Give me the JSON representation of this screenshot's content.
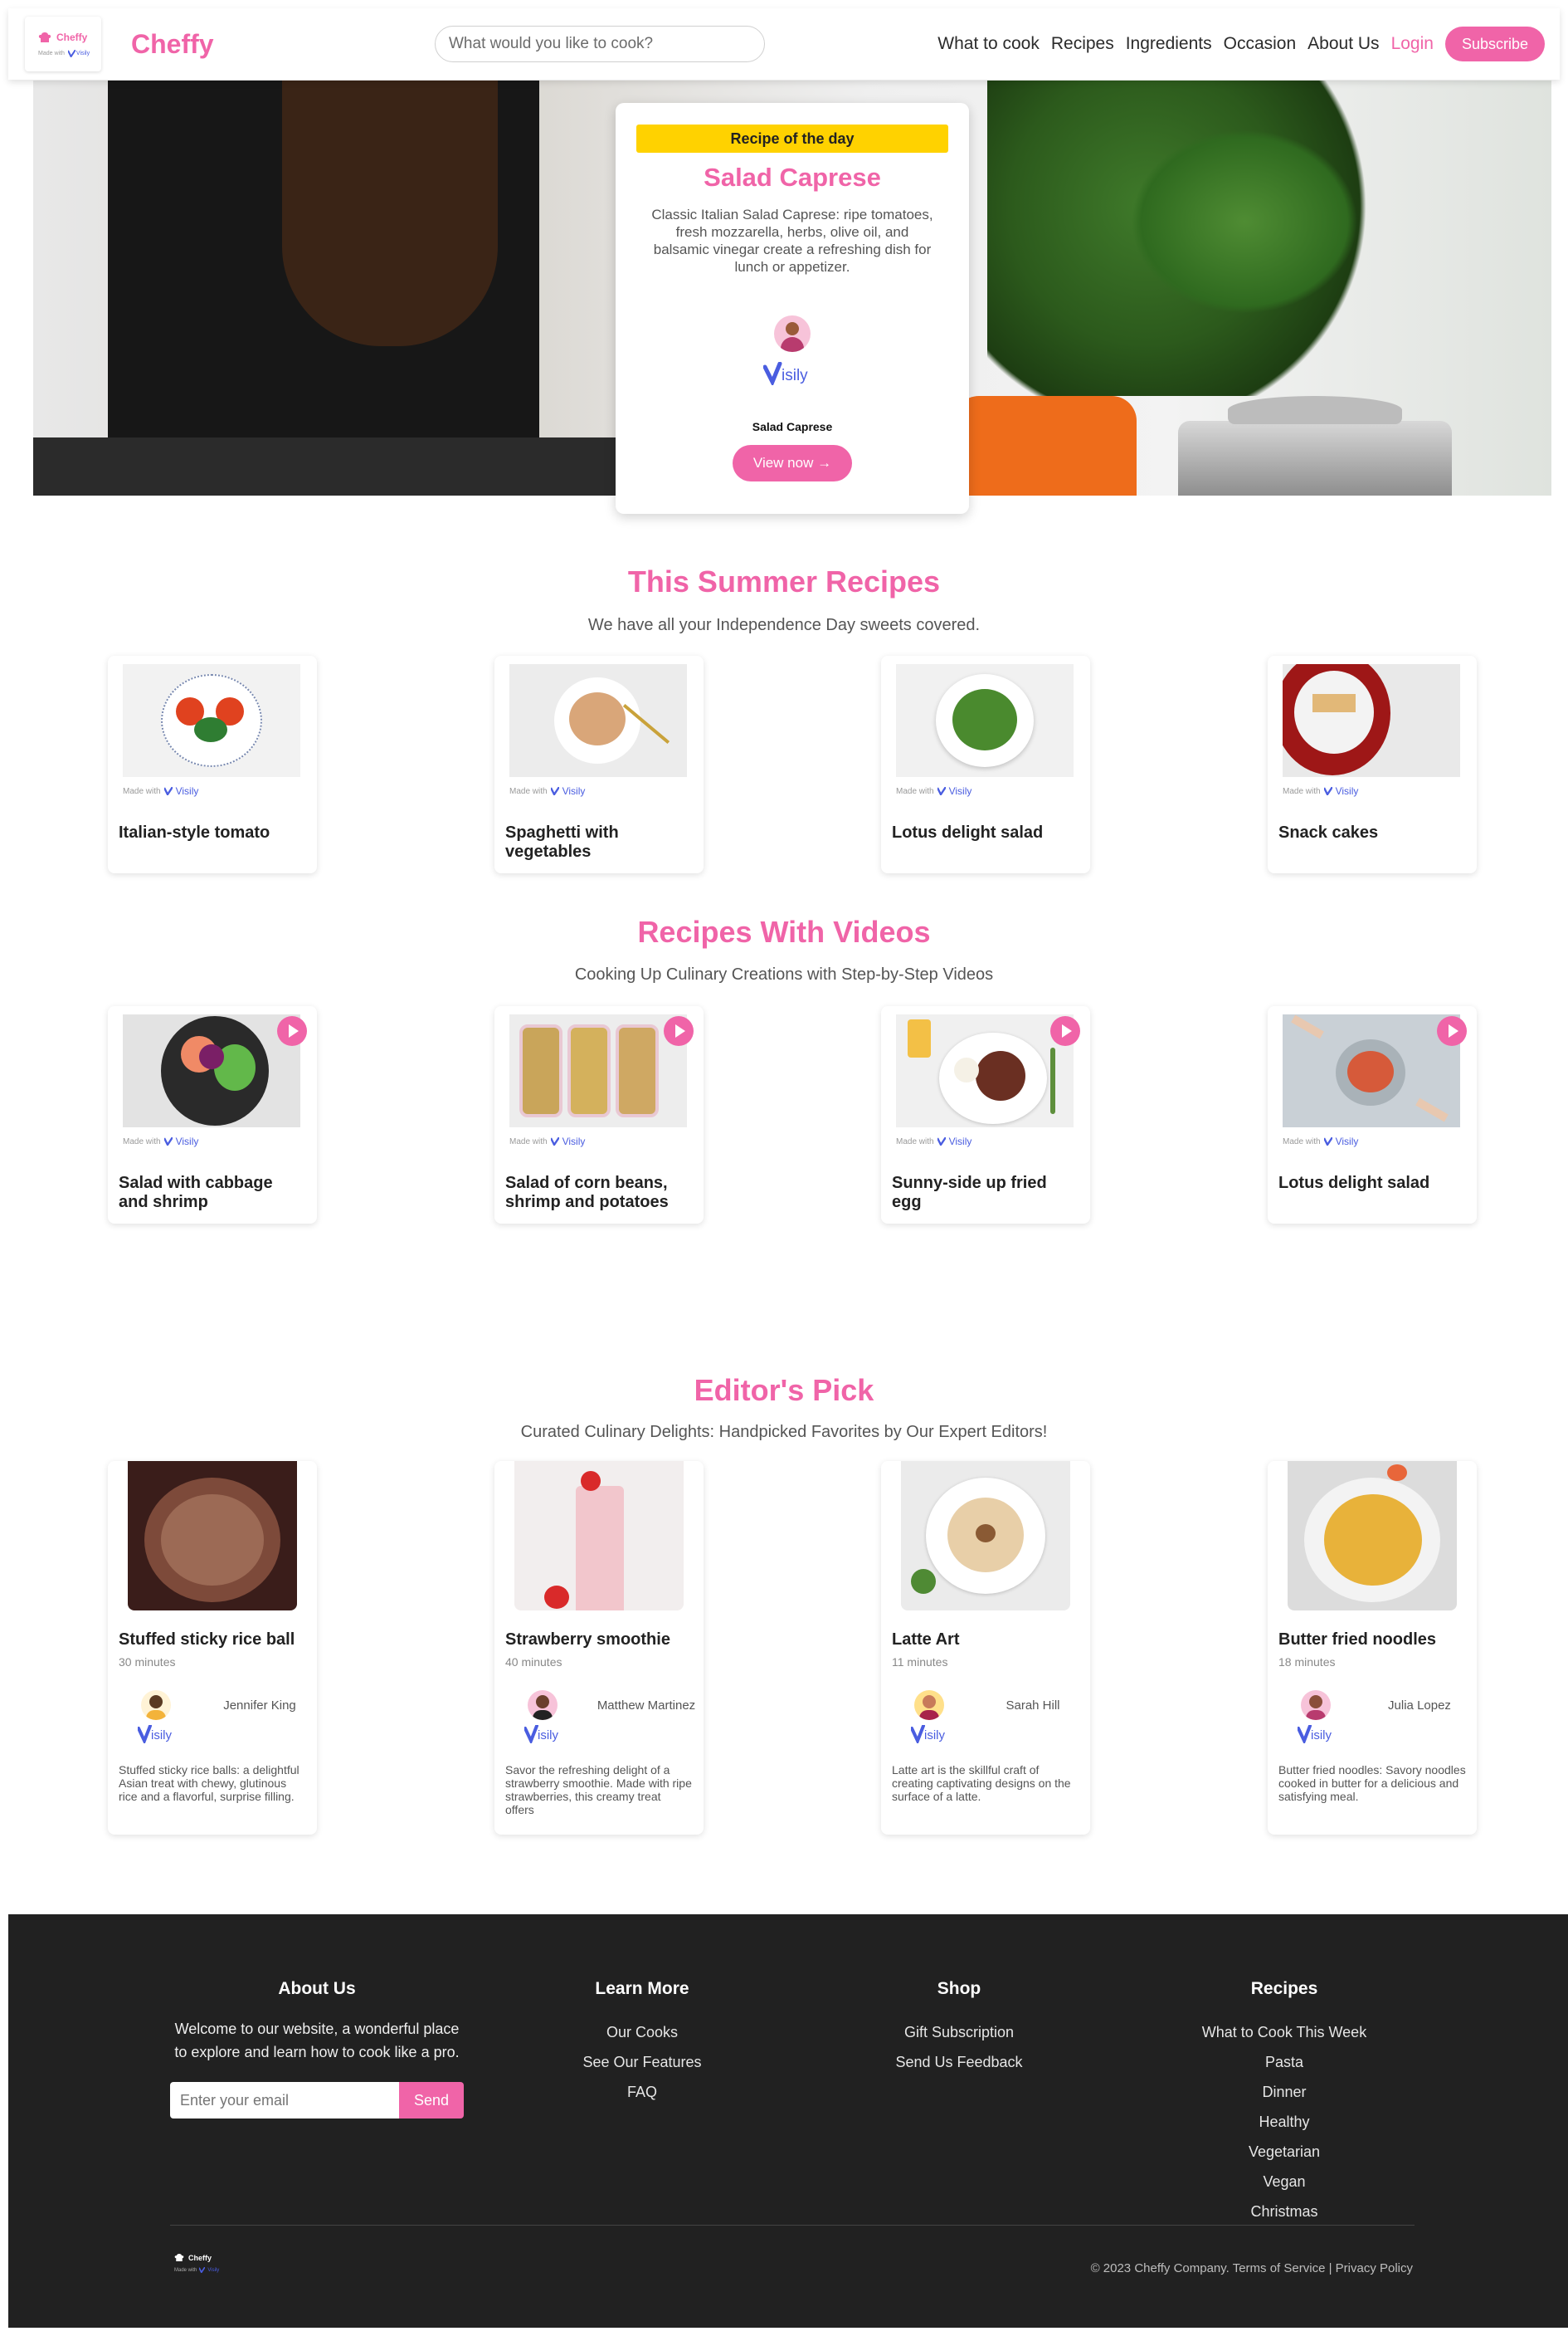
{
  "brand": {
    "logo_name": "Cheffy",
    "made_with": "Made with",
    "visily": "Visily",
    "app_name": "Cheffy"
  },
  "search": {
    "placeholder": "What would you like to cook?"
  },
  "nav": {
    "items": [
      "What to cook",
      "Recipes",
      "Ingredients",
      "Occasion",
      "About Us"
    ],
    "login": "Login",
    "subscribe": "Subscribe"
  },
  "hero": {
    "badge": "Recipe of the day",
    "title": "Salad Caprese",
    "description": "Classic Italian Salad Caprese: ripe tomatoes, fresh mozzarella, herbs, olive oil, and balsamic vinegar create a refreshing dish for lunch or appetizer.",
    "recipe_name": "Salad Caprese",
    "cta": "View now →"
  },
  "summer": {
    "title": "This Summer Recipes",
    "subtitle": "We have all your Independence Day sweets covered.",
    "cards": [
      {
        "title": "Italian-style tomato"
      },
      {
        "title": "Spaghetti with vegetables"
      },
      {
        "title": "Lotus delight salad"
      },
      {
        "title": "Snack cakes"
      }
    ]
  },
  "videos": {
    "title": "Recipes With Videos",
    "subtitle": "Cooking Up Culinary Creations with Step-by-Step Videos",
    "cards": [
      {
        "title": "Salad with cabbage and shrimp"
      },
      {
        "title": "Salad of corn beans, shrimp and potatoes"
      },
      {
        "title": "Sunny-side up fried egg"
      },
      {
        "title": "Lotus delight salad"
      }
    ]
  },
  "editors": {
    "title": "Editor's Pick",
    "subtitle": "Curated Culinary Delights: Handpicked Favorites by Our Expert Editors!",
    "cards": [
      {
        "title": "Stuffed sticky rice ball",
        "time": "30 minutes",
        "author": "Jennifer King",
        "description": "Stuffed sticky rice balls: a delightful Asian treat with chewy, glutinous rice and a flavorful, surprise filling."
      },
      {
        "title": "Strawberry smoothie",
        "time": "40 minutes",
        "author": "Matthew Martinez",
        "description": "Savor the refreshing delight of a strawberry smoothie. Made with ripe strawberries, this creamy treat offers"
      },
      {
        "title": "Latte Art",
        "time": "11 minutes",
        "author": "Sarah Hill",
        "description": "Latte art is the skillful craft of creating captivating designs on the surface of a latte."
      },
      {
        "title": "Butter fried noodles",
        "time": "18 minutes",
        "author": "Julia Lopez",
        "description": "Butter fried noodles: Savory noodles cooked in butter for a delicious and satisfying meal."
      }
    ]
  },
  "footer": {
    "about": {
      "title": "About Us",
      "text": "Welcome to our website, a wonderful place to explore and learn how to cook like a pro.",
      "email_placeholder": "Enter your email",
      "send": "Send"
    },
    "learn": {
      "title": "Learn More",
      "links": [
        "Our Cooks",
        "See Our Features",
        "FAQ"
      ]
    },
    "shop": {
      "title": "Shop",
      "links": [
        "Gift Subscription",
        "Send Us Feedback"
      ]
    },
    "recipes": {
      "title": "Recipes",
      "links": [
        "What to Cook This Week",
        "Pasta",
        "Dinner",
        "Healthy",
        "Vegetarian",
        "Vegan",
        "Christmas"
      ]
    },
    "copyright": "© 2023 Cheffy Company. Terms of Service | Privacy Policy"
  },
  "colors": {
    "accent": "#f064a8",
    "badge": "#ffd200",
    "footer_bg": "#212121"
  }
}
